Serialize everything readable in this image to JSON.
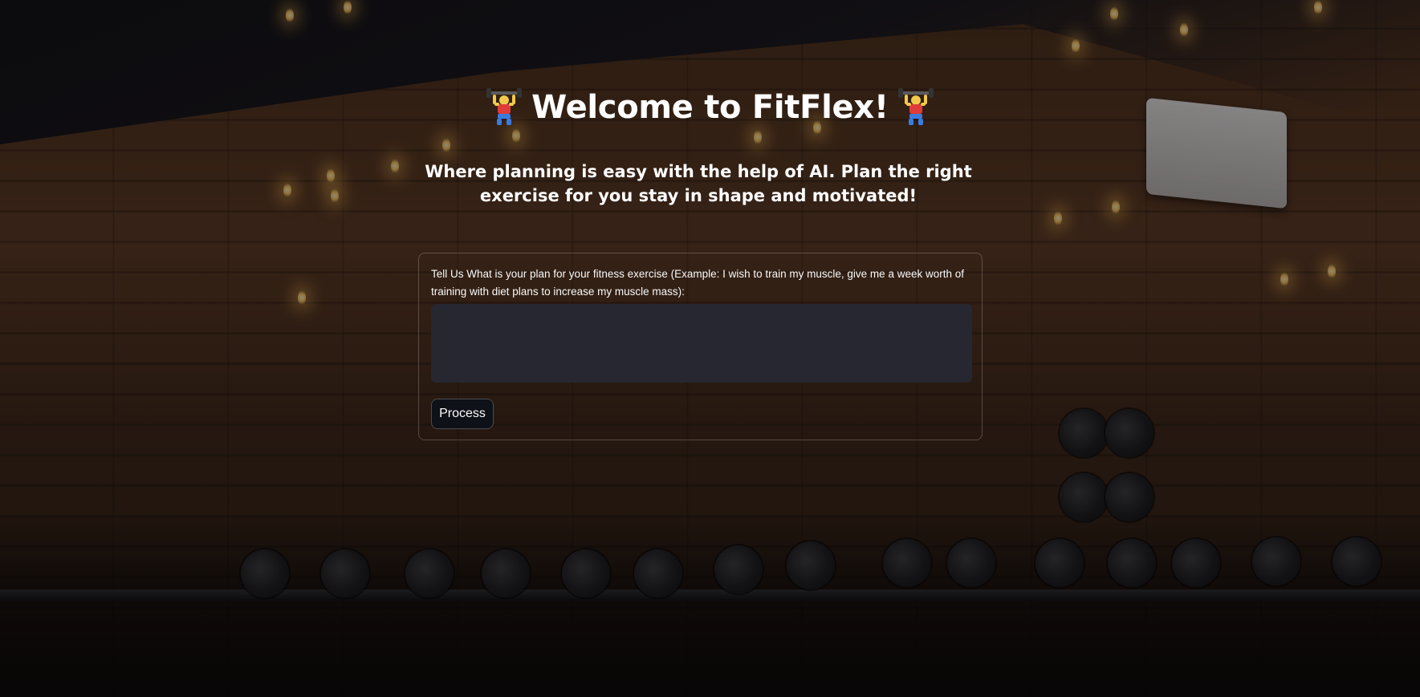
{
  "header": {
    "title": "Welcome to FitFlex!",
    "title_emoji_left": "weightlifter-icon",
    "title_emoji_right": "weightlifter-icon",
    "subtitle": "Where planning is easy with the help of AI. Plan the right exercise for you stay in shape and motivated!"
  },
  "form": {
    "label": "Tell Us What is your plan for your fitness exercise (Example: I wish to train my muscle, give me a week worth of training with diet plans to increase my muscle mass):",
    "input_value": "",
    "process_label": "Process"
  },
  "colors": {
    "text": "#fafafa",
    "input_bg": "#262730",
    "button_bg": "#0e1117"
  }
}
